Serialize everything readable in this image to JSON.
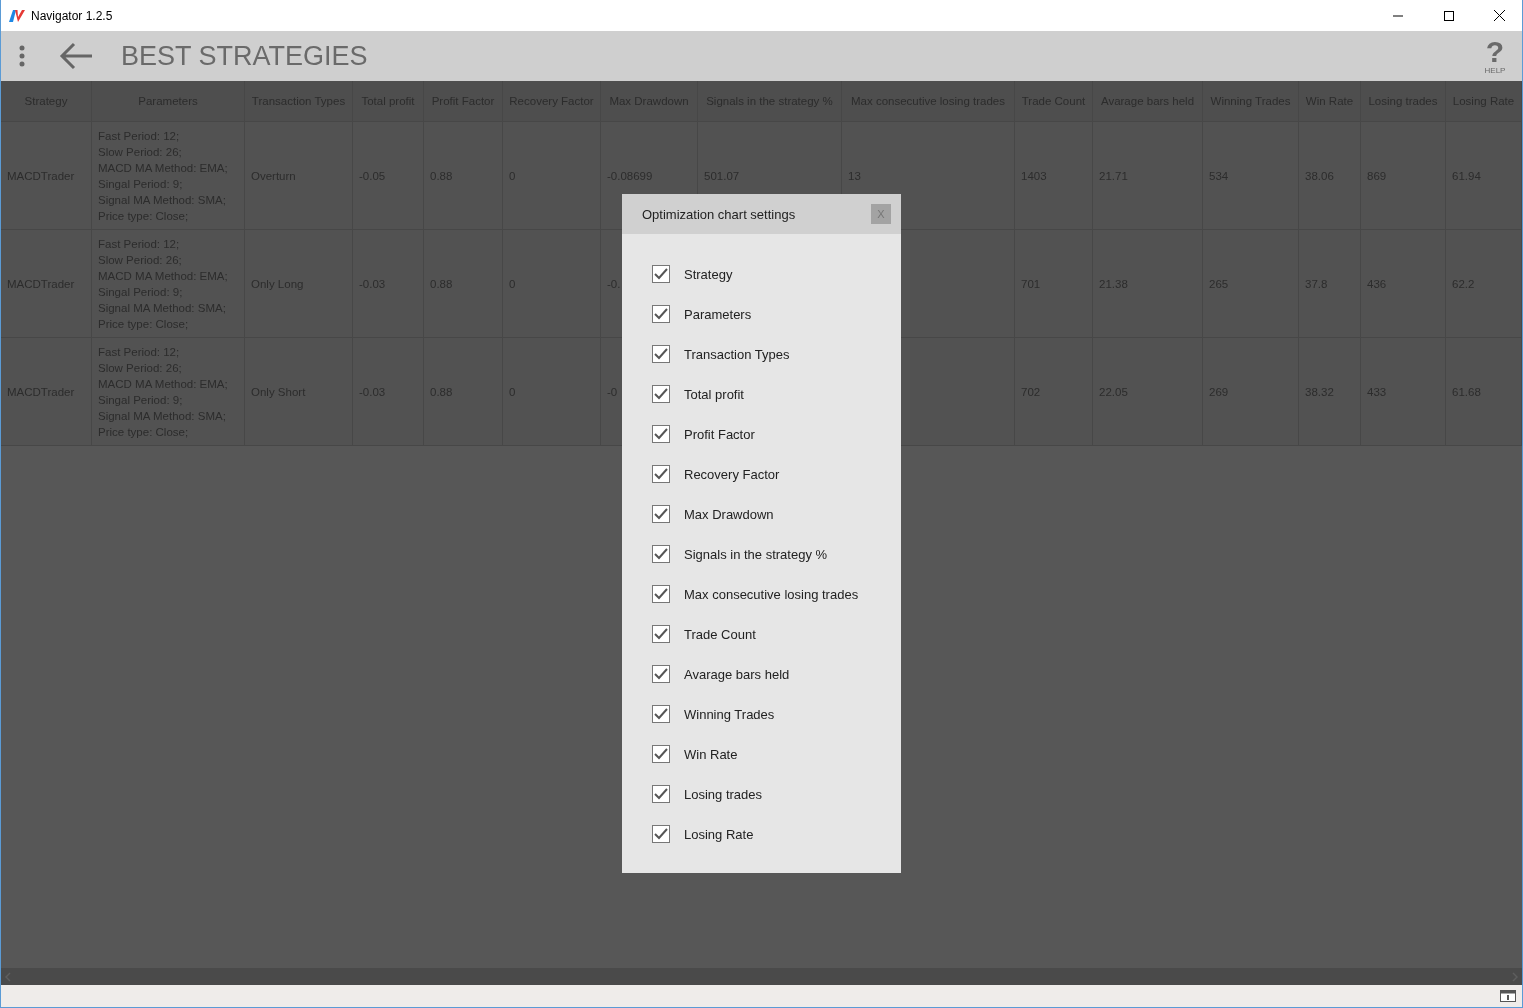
{
  "window": {
    "title": "Navigator 1.2.5"
  },
  "app_bar": {
    "title": "BEST STRATEGIES",
    "help_glyph": "?",
    "help_label": "HELP"
  },
  "table": {
    "columns": [
      "Strategy",
      "Parameters",
      "Transaction Types",
      "Total profit",
      "Profit Factor",
      "Recovery Factor",
      "Max Drawdown",
      "Signals in the strategy %",
      "Max consecutive losing trades",
      "Trade Count",
      "Avarage bars held",
      "Winning Trades",
      "Win Rate",
      "Losing trades",
      "Losing Rate"
    ],
    "rows": [
      {
        "cells": [
          "MACDTrader",
          "Fast Period: 12;\nSlow Period: 26;\nMACD MA Method: EMA;\nSingal Period: 9;\nSignal MA Method: SMA;\nPrice type: Close;",
          "Overturn",
          "-0.05",
          "0.88",
          "0",
          "-0.08699",
          "501.07",
          "13",
          "1403",
          "21.71",
          "534",
          "38.06",
          "869",
          "61.94"
        ]
      },
      {
        "cells": [
          "MACDTrader",
          "Fast Period: 12;\nSlow Period: 26;\nMACD MA Method: EMA;\nSingal Period: 9;\nSignal MA Method: SMA;\nPrice type: Close;",
          "Only Long",
          "-0.03",
          "0.88",
          "0",
          "-0.",
          null,
          null,
          "701",
          "21.38",
          "265",
          "37.8",
          "436",
          "62.2"
        ]
      },
      {
        "cells": [
          "MACDTrader",
          "Fast Period: 12;\nSlow Period: 26;\nMACD MA Method: EMA;\nSingal Period: 9;\nSignal MA Method: SMA;\nPrice type: Close;",
          "Only Short",
          "-0.03",
          "0.88",
          "0",
          "-0",
          null,
          null,
          "702",
          "22.05",
          "269",
          "38.32",
          "433",
          "61.68"
        ]
      }
    ]
  },
  "dialog": {
    "title": "Optimization chart settings",
    "close_label": "X",
    "options": [
      {
        "label": "Strategy",
        "checked": true
      },
      {
        "label": "Parameters",
        "checked": true
      },
      {
        "label": "Transaction Types",
        "checked": true
      },
      {
        "label": "Total profit",
        "checked": true
      },
      {
        "label": "Profit Factor",
        "checked": true
      },
      {
        "label": "Recovery Factor",
        "checked": true
      },
      {
        "label": "Max Drawdown",
        "checked": true
      },
      {
        "label": "Signals in the strategy %",
        "checked": true
      },
      {
        "label": "Max consecutive losing trades",
        "checked": true
      },
      {
        "label": "Trade Count",
        "checked": true
      },
      {
        "label": "Avarage bars held",
        "checked": true
      },
      {
        "label": "Winning Trades",
        "checked": true
      },
      {
        "label": "Win Rate",
        "checked": true
      },
      {
        "label": "Losing trades",
        "checked": true
      },
      {
        "label": "Losing Rate",
        "checked": true
      }
    ]
  }
}
